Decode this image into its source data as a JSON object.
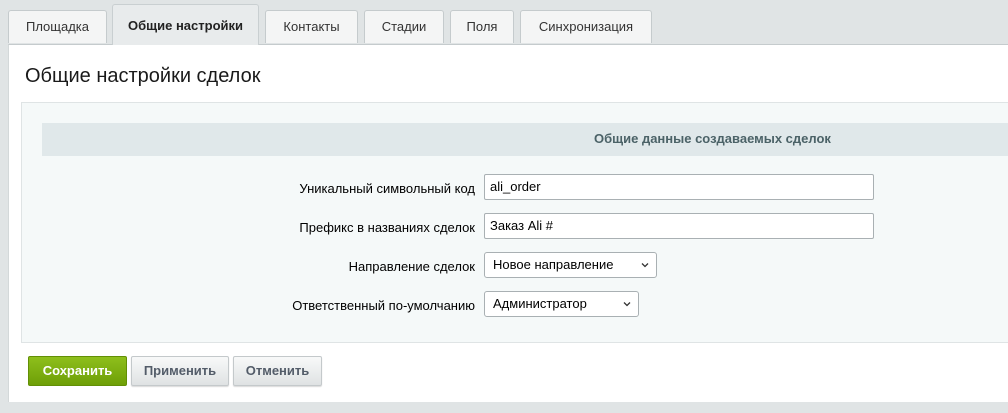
{
  "tabs": [
    {
      "label": "Площадка",
      "active": false
    },
    {
      "label": "Общие настройки",
      "active": true
    },
    {
      "label": "Контакты",
      "active": false
    },
    {
      "label": "Стадии",
      "active": false
    },
    {
      "label": "Поля",
      "active": false
    },
    {
      "label": "Синхронизация",
      "active": false
    }
  ],
  "page": {
    "title": "Общие настройки сделок",
    "section_title": "Общие данные создаваемых сделок"
  },
  "form": {
    "code_label": "Уникальный символьный код",
    "code_value": "ali_order",
    "prefix_label": "Префикс в названиях сделок",
    "prefix_value": "Заказ Ali #",
    "direction_label": "Направление сделок",
    "direction_value": "Новое направление",
    "responsible_label": "Ответственный по-умолчанию",
    "responsible_value": "Администратор"
  },
  "buttons": {
    "save": "Сохранить",
    "apply": "Применить",
    "cancel": "Отменить"
  },
  "icons": {
    "select_arrow": "chevron-down-icon"
  },
  "colors": {
    "primary_button": "#7bad0f",
    "section_header_bg": "#e0e8ea",
    "section_header_text": "#4b6267",
    "page_bg": "#e0e4e5"
  }
}
